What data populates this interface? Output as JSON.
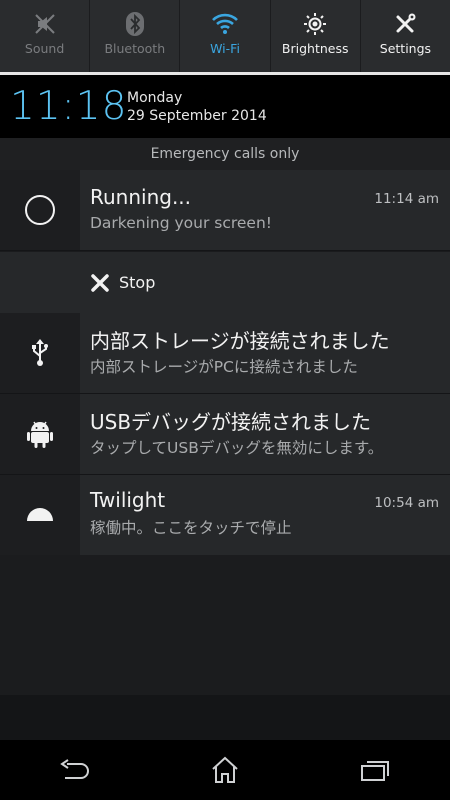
{
  "quick_settings": [
    {
      "id": "sound",
      "label": "Sound",
      "state": "off",
      "icon": "sound-muted-icon"
    },
    {
      "id": "bluetooth",
      "label": "Bluetooth",
      "state": "off",
      "icon": "bluetooth-icon"
    },
    {
      "id": "wifi",
      "label": "Wi-Fi",
      "state": "on",
      "icon": "wifi-icon"
    },
    {
      "id": "brightness",
      "label": "Brightness",
      "state": "plain",
      "icon": "brightness-icon"
    },
    {
      "id": "settings",
      "label": "Settings",
      "state": "plain",
      "icon": "settings-icon"
    }
  ],
  "header": {
    "time": "11:18",
    "day": "Monday",
    "date": "29 September 2014"
  },
  "carrier_text": "Emergency calls only",
  "notifications": {
    "running": {
      "title": "Running...",
      "text": "Darkening your screen!",
      "time": "11:14 am",
      "action_label": "Stop"
    },
    "storage": {
      "title": "内部ストレージが接続されました",
      "text": "内部ストレージがPCに接続されました"
    },
    "usb_debug": {
      "title": "USBデバッグが接続されました",
      "text": "タップしてUSBデバッグを無効にします。"
    },
    "twilight": {
      "title": "Twilight",
      "text": "稼働中。ここをタッチで停止",
      "time": "10:54 am"
    }
  },
  "colors": {
    "accent_blue": "#3aa6e0",
    "clock_blue": "#5cc3f2"
  }
}
